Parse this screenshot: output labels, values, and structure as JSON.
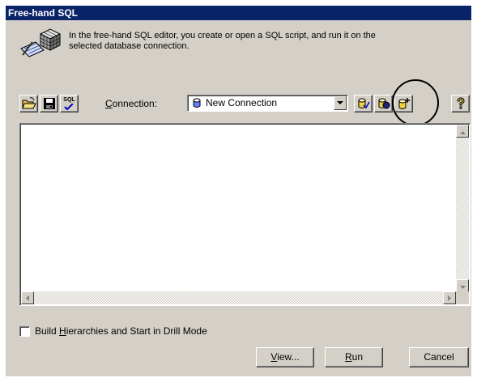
{
  "window": {
    "title": "Free-hand SQL"
  },
  "intro": {
    "line1": "In the free-hand SQL editor, you create or open a SQL script, and run it on the",
    "line2": "selected database connection."
  },
  "toolbar": {
    "sql_icon_text": "SQL",
    "connection_label_prefix": "C",
    "connection_label_rest": "onnection:",
    "connection_value": "New Connection",
    "help_icon_text": "?"
  },
  "editor": {
    "content": ""
  },
  "options": {
    "drill_label_pre": "Build ",
    "drill_label_accel": "H",
    "drill_label_post": "ierarchies and Start in Drill Mode",
    "drill_checked": false
  },
  "buttons": {
    "view_accel": "V",
    "view_rest": "iew...",
    "run_accel": "R",
    "run_rest": "un",
    "cancel": "Cancel"
  },
  "colors": {
    "titlebar": "#0a246a",
    "face": "#d4d0c8",
    "highlight_circle": "#000000"
  },
  "icons": {
    "intro": "sql-editor-cube-icon",
    "open": "open-folder-icon",
    "save": "floppy-disk-icon",
    "sql": "sql-check-icon",
    "connection": "database-cylinder-icon",
    "edit_conn": "edit-connection-icon",
    "remove_conn": "remove-connection-icon",
    "new_conn": "new-connection-icon",
    "help": "question-mark-icon"
  }
}
